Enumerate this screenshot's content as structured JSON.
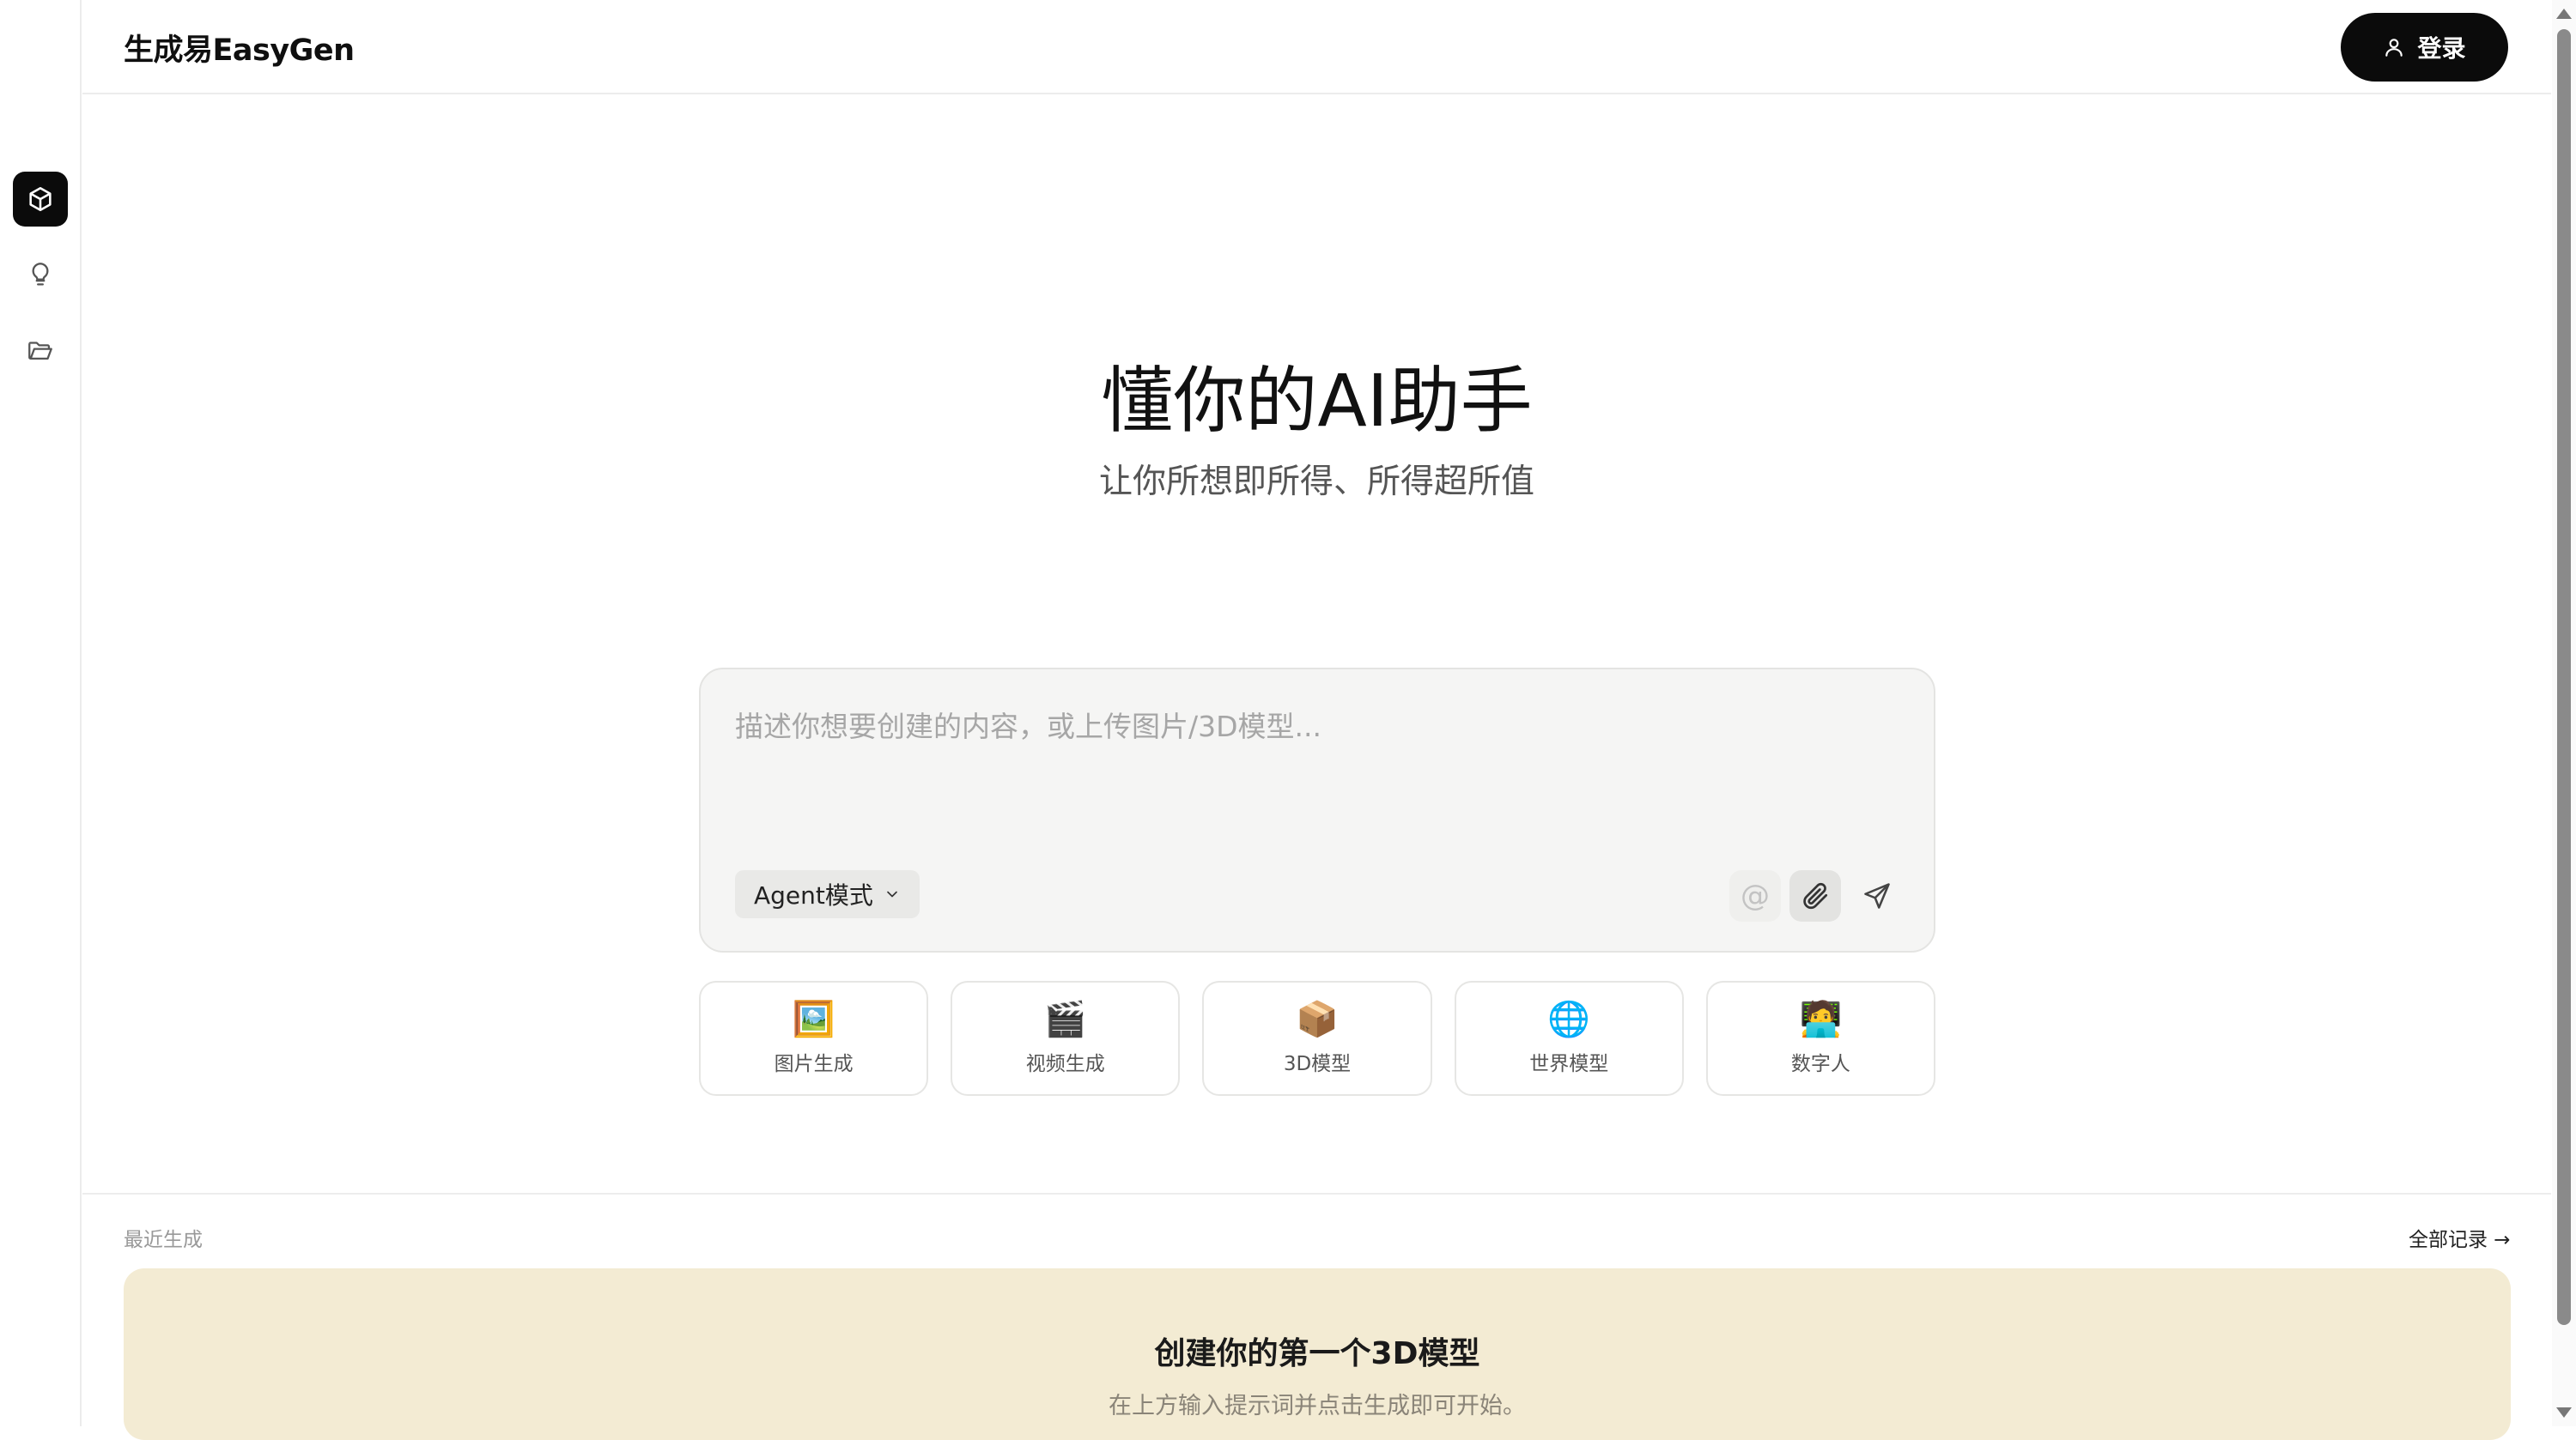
{
  "header": {
    "brand": "生成易EasyGen",
    "login_label": "登录"
  },
  "sidebar": {
    "items": [
      {
        "icon": "cube-icon",
        "active": true
      },
      {
        "icon": "lightbulb-icon",
        "active": false
      },
      {
        "icon": "folder-open-icon",
        "active": false
      }
    ]
  },
  "hero": {
    "title": "懂你的AI助手",
    "subtitle": "让你所想即所得、所得超所值"
  },
  "composer": {
    "placeholder": "描述你想要创建的内容，或上传图片/3D模型...",
    "mode_label": "Agent模式",
    "at_symbol": "@"
  },
  "features": [
    {
      "label": "图片生成",
      "icon": "🖼️"
    },
    {
      "label": "视频生成",
      "icon": "🎬"
    },
    {
      "label": "3D模型",
      "icon": "📦"
    },
    {
      "label": "世界模型",
      "icon": "🌐"
    },
    {
      "label": "数字人",
      "icon": "🧑‍💻"
    }
  ],
  "recent": {
    "section_label": "最近生成",
    "all_link": "全部记录 →",
    "empty_title": "创建你的第一个3D模型",
    "empty_subtitle": "在上方输入提示词并点击生成即可开始。"
  },
  "colors": {
    "accent": "#0b0b0b",
    "banner_bg": "#f3ebd3",
    "composer_bg": "#f5f5f4"
  }
}
